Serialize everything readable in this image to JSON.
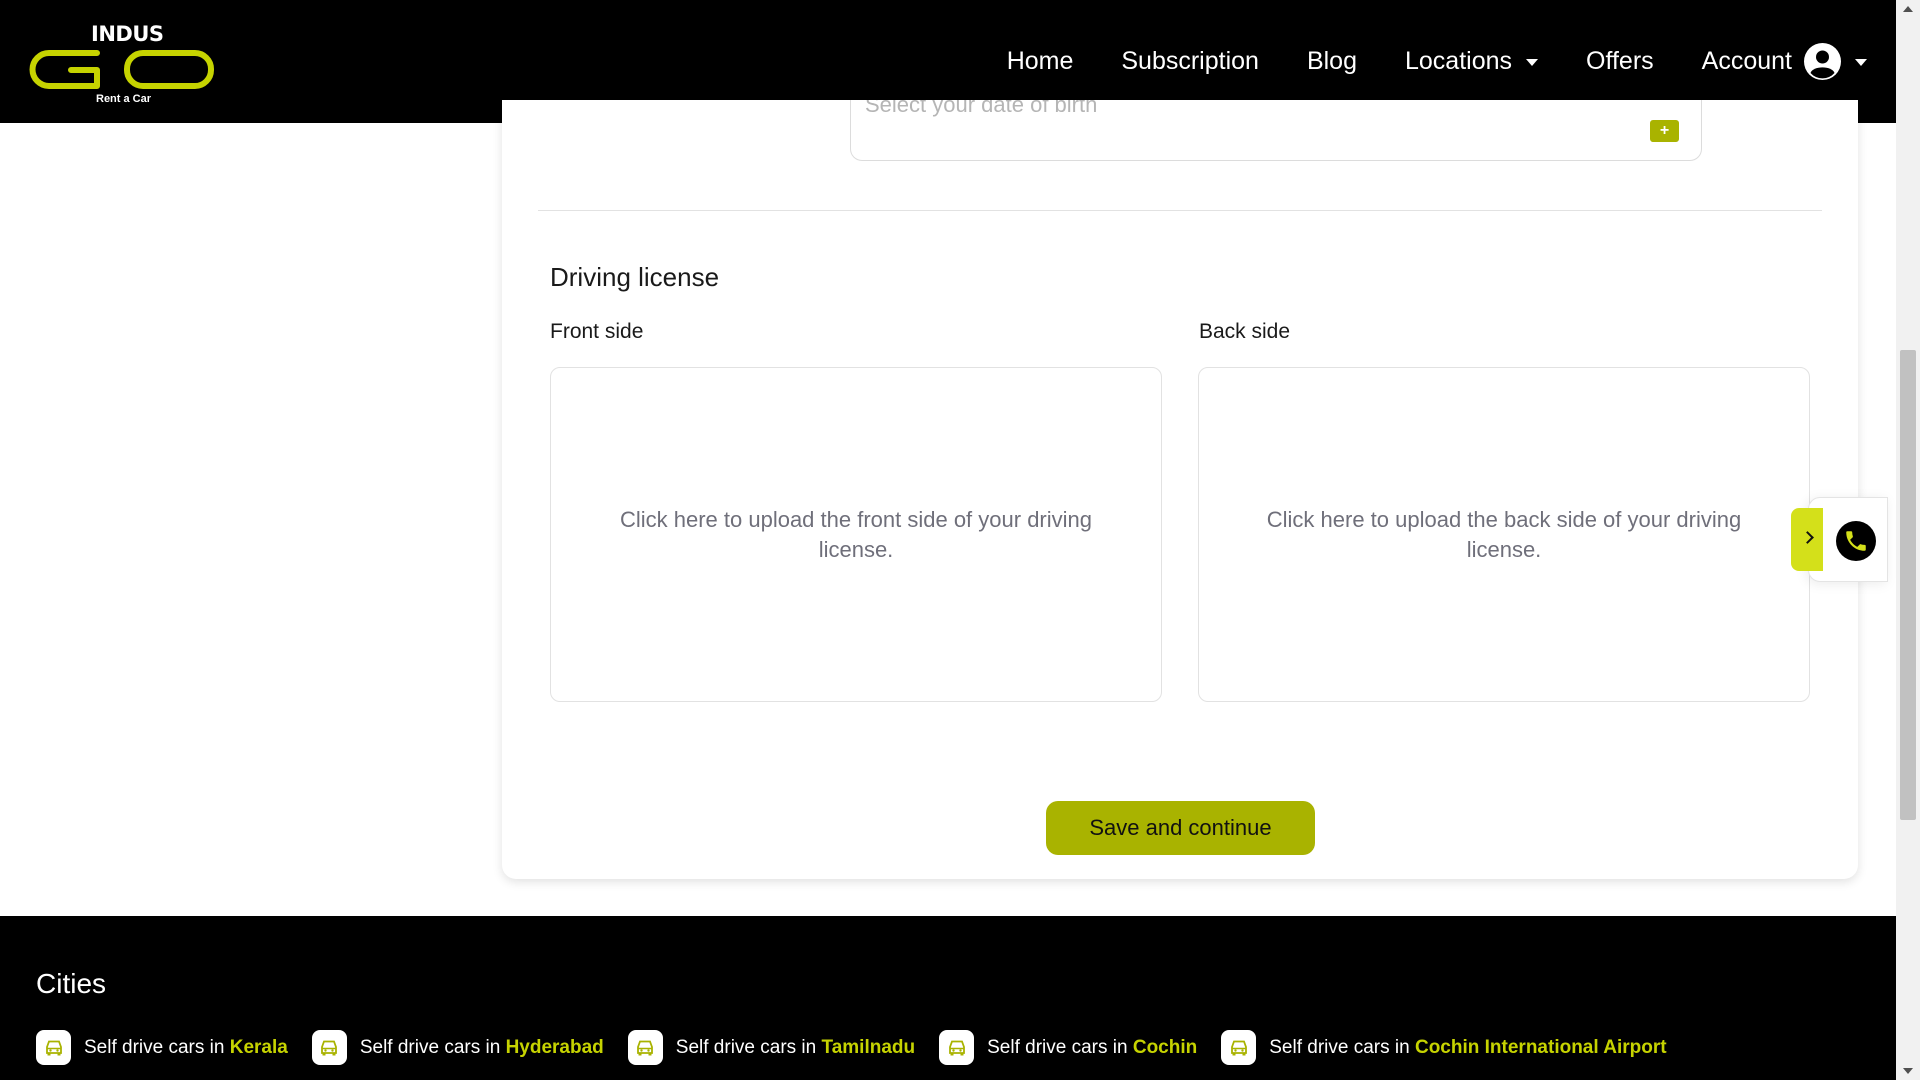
{
  "brand": {
    "top": "INDUS",
    "wordmark": "GO",
    "tagline": "Rent a Car",
    "accent_color": "#a9b300",
    "highlight_color": "#c6d300"
  },
  "nav": {
    "home": "Home",
    "subscription": "Subscription",
    "blog": "Blog",
    "locations": "Locations",
    "offers": "Offers",
    "account": "Account"
  },
  "form": {
    "dob_placeholder": "Select your date of birth",
    "dob_button": "+",
    "section_title": "Driving license",
    "front_label": "Front side",
    "back_label": "Back side",
    "front_upload_text": "Click here to upload the front side of your driving license.",
    "back_upload_text": "Click here to upload the back side of your driving license.",
    "save_label": "Save and continue"
  },
  "call_widget": {
    "icons": [
      "chevron-right-icon",
      "phone-icon"
    ]
  },
  "footer": {
    "title": "Cities",
    "prefix": "Self drive cars in ",
    "cities": [
      {
        "name": "Kerala"
      },
      {
        "name": "Hyderabad"
      },
      {
        "name": "Tamilnadu"
      },
      {
        "name": "Cochin"
      },
      {
        "name": "Cochin International Airport"
      }
    ]
  }
}
